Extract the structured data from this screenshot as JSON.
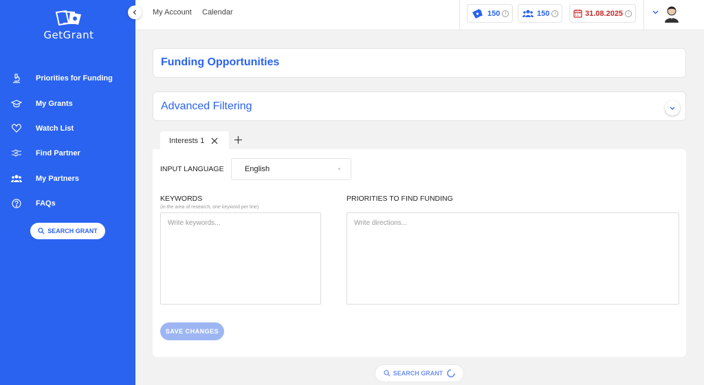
{
  "brand": {
    "name": "GetGrant"
  },
  "sidebar": {
    "items": [
      {
        "label": "Priorities for Funding",
        "icon": "microscope-icon"
      },
      {
        "label": "My Grants",
        "icon": "graduation-cap-icon"
      },
      {
        "label": "Watch List",
        "icon": "heart-icon"
      },
      {
        "label": "Find Partner",
        "icon": "handshake-icon"
      },
      {
        "label": "My Partners",
        "icon": "users-icon"
      },
      {
        "label": "FAQs",
        "icon": "help-circle-icon"
      }
    ],
    "search_label": "SEARCH GRANT"
  },
  "topbar": {
    "links": [
      "My Account",
      "Calendar"
    ],
    "credits": "150",
    "partners": "150",
    "date": "31.08.2025"
  },
  "funding": {
    "title": "Funding Opportunities"
  },
  "filtering": {
    "title": "Advanced Filtering"
  },
  "tabs": [
    {
      "label": "Interests 1"
    }
  ],
  "form": {
    "language_label": "INPUT LANGUAGE",
    "language_value": "English",
    "keywords_label": "KEYWORDS",
    "keywords_hint": "(in the area of research, one keyword per line)",
    "keywords_placeholder": "Write keywords...",
    "priorities_label": "PRIORITIES TO FIND FUNDING",
    "priorities_placeholder": "Write directions...",
    "save_label": "SAVE CHANGES"
  },
  "bottom": {
    "search_label": "SEARCH GRANT"
  },
  "colors": {
    "primary": "#2a63f0",
    "danger": "#c62828",
    "disabled": "#9db6f3"
  }
}
